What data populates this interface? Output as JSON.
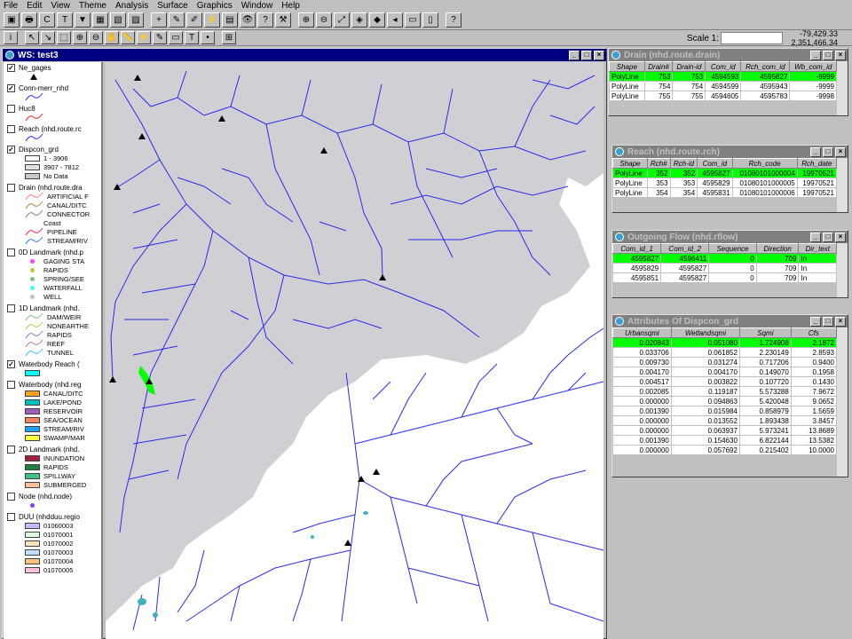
{
  "menubar": [
    "File",
    "Edit",
    "View",
    "Theme",
    "Analysis",
    "Surface",
    "Graphics",
    "Window",
    "Help"
  ],
  "toolbar1": [
    {
      "name": "save-icon",
      "glyph": "▣"
    },
    {
      "name": "print-icon",
      "glyph": "🖶"
    },
    {
      "name": "layout-icon",
      "glyph": "C"
    },
    {
      "name": "zoom-full-icon",
      "glyph": "T"
    },
    {
      "name": "down-arrow-icon",
      "glyph": "▼"
    },
    {
      "name": "table-icon",
      "glyph": "▦"
    },
    {
      "name": "chart-icon",
      "glyph": "▧"
    },
    {
      "name": "layout2-icon",
      "glyph": "▨"
    },
    {
      "name": "add-theme-icon",
      "glyph": "+"
    },
    {
      "name": "theme-props-icon",
      "glyph": "✎"
    },
    {
      "name": "edit-legend-icon",
      "glyph": "✐"
    },
    {
      "name": "hotlink-icon",
      "glyph": "⚡"
    },
    {
      "name": "open-table-icon",
      "glyph": "▤"
    },
    {
      "name": "binoculars-icon",
      "glyph": "👁"
    },
    {
      "name": "query-icon",
      "glyph": "?"
    },
    {
      "name": "hammer-icon",
      "glyph": "⚒"
    },
    {
      "name": "zoom-in-icon",
      "glyph": "⊕"
    },
    {
      "name": "zoom-out-icon",
      "glyph": "⊖"
    },
    {
      "name": "full-extent-icon",
      "glyph": "⤢"
    },
    {
      "name": "zoom-active-icon",
      "glyph": "◈"
    },
    {
      "name": "zoom-selected-icon",
      "glyph": "◆"
    },
    {
      "name": "zoom-previous-icon",
      "glyph": "◂"
    },
    {
      "name": "select-icon",
      "glyph": "▭"
    },
    {
      "name": "clear-select-icon",
      "glyph": "▯"
    },
    {
      "name": "help-icon",
      "glyph": "?"
    }
  ],
  "toolbar2": [
    {
      "name": "identify-icon",
      "glyph": "i"
    },
    {
      "name": "pointer-icon",
      "glyph": "↖"
    },
    {
      "name": "vertex-edit-icon",
      "glyph": "↘"
    },
    {
      "name": "select-feature-icon",
      "glyph": "⬚"
    },
    {
      "name": "zoom-in-tool-icon",
      "glyph": "⊕"
    },
    {
      "name": "zoom-out-tool-icon",
      "glyph": "⊖"
    },
    {
      "name": "pan-icon",
      "glyph": "✋"
    },
    {
      "name": "measure-icon",
      "glyph": "📏"
    },
    {
      "name": "hotlink-tool-icon",
      "glyph": "⚡"
    },
    {
      "name": "label-icon",
      "glyph": "✎"
    },
    {
      "name": "area-of-interest-icon",
      "glyph": "▭"
    },
    {
      "name": "text-tool-icon",
      "glyph": "T"
    },
    {
      "name": "draw-tool-icon",
      "glyph": "•"
    },
    {
      "name": "snap-icon",
      "glyph": "⊞"
    }
  ],
  "scale": {
    "label": "Scale 1:",
    "value": ""
  },
  "coords": {
    "x": "-79,429.33",
    "y": "2,351,466.34"
  },
  "view_window": {
    "title": "WS: test3"
  },
  "toc": [
    {
      "label": "Ne_gages",
      "checked": true,
      "legend": [
        {
          "kind": "triangle",
          "color": "#000000",
          "label": ""
        }
      ]
    },
    {
      "label": "Conn-merr_nhd",
      "checked": true,
      "legend": [
        {
          "kind": "line",
          "color": "#3030ff",
          "label": ""
        }
      ]
    },
    {
      "label": "Huc8",
      "checked": false,
      "legend": [
        {
          "kind": "line",
          "color": "#ff2020",
          "label": ""
        }
      ]
    },
    {
      "label": "Reach (nhd.route.rc",
      "checked": false,
      "legend": [
        {
          "kind": "line",
          "color": "#3030ff",
          "label": ""
        }
      ]
    },
    {
      "label": "Dispcon_grd",
      "checked": true,
      "legend": [
        {
          "kind": "swatch",
          "color": "#ffffff",
          "label": "1 - 3906"
        },
        {
          "kind": "swatch",
          "color": "#e0e0e0",
          "label": "3907 - 7812"
        },
        {
          "kind": "swatch",
          "color": "#c8c8c8",
          "label": "No Data"
        }
      ]
    },
    {
      "label": "Drain (nhd.route.dra",
      "checked": false,
      "legend": [
        {
          "kind": "line",
          "color": "#ff8080",
          "label": "ARTIFICIAL F"
        },
        {
          "kind": "line",
          "color": "#c08040",
          "label": "CANAL/DITC"
        },
        {
          "kind": "line",
          "color": "#808080",
          "label": "CONNECTOR"
        },
        {
          "kind": "text",
          "color": "",
          "label": "Coast"
        },
        {
          "kind": "line",
          "color": "#ff2060",
          "label": "PIPELINE"
        },
        {
          "kind": "line",
          "color": "#3080ff",
          "label": "STREAM/RIV"
        }
      ]
    },
    {
      "label": "0D Landmark (nhd.p",
      "checked": false,
      "legend": [
        {
          "kind": "dot",
          "color": "#ff40ff",
          "label": "GAGING STA"
        },
        {
          "kind": "dot",
          "color": "#c0c040",
          "label": "RAPIDS"
        },
        {
          "kind": "dot",
          "color": "#80c080",
          "label": "SPRING/SEE"
        },
        {
          "kind": "dot",
          "color": "#40ffff",
          "label": "WATERFALL"
        },
        {
          "kind": "dot",
          "color": "#c0c0c0",
          "label": "WELL"
        }
      ]
    },
    {
      "label": "1D Landmark (nhd.",
      "checked": false,
      "legend": [
        {
          "kind": "line",
          "color": "#80c080",
          "label": "DAM/WEIR"
        },
        {
          "kind": "line",
          "color": "#c0c040",
          "label": "NONEARTHE"
        },
        {
          "kind": "line",
          "color": "#8080c0",
          "label": "RAPIDS"
        },
        {
          "kind": "line",
          "color": "#c08080",
          "label": "REEF"
        },
        {
          "kind": "line",
          "color": "#40c0ff",
          "label": "TUNNEL"
        }
      ]
    },
    {
      "label": "Waterbody Reach (",
      "checked": true,
      "legend": [
        {
          "kind": "swatch",
          "color": "#00ffff",
          "label": ""
        }
      ]
    },
    {
      "label": "Waterbody (nhd.reg",
      "checked": false,
      "legend": [
        {
          "kind": "swatch",
          "color": "#ffa020",
          "label": "CANAL/DITC"
        },
        {
          "kind": "swatch",
          "color": "#00c0c0",
          "label": "LAKE/POND"
        },
        {
          "kind": "swatch",
          "color": "#a060c0",
          "label": "RESERVOIR"
        },
        {
          "kind": "swatch",
          "color": "#ff8060",
          "label": "SEA/OCEAN"
        },
        {
          "kind": "swatch",
          "color": "#20a0ff",
          "label": "STREAM/RIV"
        },
        {
          "kind": "swatch",
          "color": "#ffff40",
          "label": "SWAMP/MAR"
        }
      ]
    },
    {
      "label": "2D Landmark (nhd.",
      "checked": false,
      "legend": [
        {
          "kind": "swatch",
          "color": "#a02040",
          "label": "INUNDATION"
        },
        {
          "kind": "swatch",
          "color": "#208040",
          "label": "RAPIDS"
        },
        {
          "kind": "swatch",
          "color": "#40c080",
          "label": "SPILLWAY"
        },
        {
          "kind": "swatch",
          "color": "#ffc0a0",
          "label": "SUBMERGED"
        }
      ]
    },
    {
      "label": "Node (nhd.node)",
      "checked": false,
      "legend": [
        {
          "kind": "dot",
          "color": "#8040ff",
          "label": ""
        }
      ]
    },
    {
      "label": "DUU (nhdduu.regio",
      "checked": false,
      "legend": [
        {
          "kind": "swatch",
          "color": "#c0c0ff",
          "label": "01060003"
        },
        {
          "kind": "swatch",
          "color": "#e0ffe0",
          "label": "01070001"
        },
        {
          "kind": "swatch",
          "color": "#ffe0c0",
          "label": "01070002"
        },
        {
          "kind": "swatch",
          "color": "#c0e0ff",
          "label": "01070003"
        },
        {
          "kind": "swatch",
          "color": "#ffc080",
          "label": "01070004"
        },
        {
          "kind": "swatch",
          "color": "#ffc0e0",
          "label": "01070005"
        }
      ]
    }
  ],
  "gages": [
    [
      155,
      88
    ],
    [
      250,
      134
    ],
    [
      160,
      154
    ],
    [
      365,
      170
    ],
    [
      132,
      211
    ],
    [
      431,
      313
    ],
    [
      127,
      428
    ],
    [
      168,
      430
    ],
    [
      424,
      532
    ],
    [
      407,
      540
    ],
    [
      392,
      612
    ]
  ],
  "drain_table": {
    "title": "Drain (nhd.route.drain)",
    "columns": [
      "Shape",
      "Drain#",
      "Drain-id",
      "Com_id",
      "Rch_com_id",
      "Wb_com_id"
    ],
    "rows": [
      [
        "PolyLine",
        "753",
        "753",
        "4594593",
        "4595827",
        "-9999"
      ],
      [
        "PolyLine",
        "754",
        "754",
        "4594599",
        "4595943",
        "-9999"
      ],
      [
        "PolyLine",
        "755",
        "755",
        "4594605",
        "4595783",
        "-9998"
      ]
    ]
  },
  "reach_table": {
    "title": "Reach (nhd.route.rch)",
    "columns": [
      "Shape",
      "Rch#",
      "Rch-id",
      "Com_id",
      "Rch_code",
      "Rch_date"
    ],
    "rows": [
      [
        "PolyLine",
        "352",
        "352",
        "4595827",
        "01080101000004",
        "19970521"
      ],
      [
        "PolyLine",
        "353",
        "353",
        "4595829",
        "01080101000005",
        "19970521"
      ],
      [
        "PolyLine",
        "354",
        "354",
        "4595831",
        "01080101000006",
        "19970521"
      ]
    ]
  },
  "flow_table": {
    "title": "Outgoing Flow (nhd.rflow)",
    "columns": [
      "Com_id_1",
      "Com_id_2",
      "Sequence",
      "Direction",
      "Dir_text"
    ],
    "rows": [
      [
        "4595827",
        "4596411",
        "0",
        "709",
        "In"
      ],
      [
        "4595829",
        "4595827",
        "0",
        "709",
        "In"
      ],
      [
        "4595851",
        "4595827",
        "0",
        "709",
        "In"
      ]
    ]
  },
  "attr_table": {
    "title": "Attributes Of Dispcon_grd",
    "columns": [
      "Urbansqmi",
      "Wetlandsqmi",
      "Sqmi",
      "Cfs"
    ],
    "rows": [
      [
        "0.020843",
        "0.051080",
        "1.724908",
        "2.1872"
      ],
      [
        "0.033706",
        "0.061852",
        "2.230149",
        "2.8593"
      ],
      [
        "0.009730",
        "0.031274",
        "0.717206",
        "0.9400"
      ],
      [
        "0.004170",
        "0.004170",
        "0.149070",
        "0.1958"
      ],
      [
        "0.004517",
        "0.003822",
        "0.107720",
        "0.1430"
      ],
      [
        "0.002085",
        "0.119187",
        "5.573288",
        "7.9672"
      ],
      [
        "0.000000",
        "0.094863",
        "5.420048",
        "9.0652"
      ],
      [
        "0.001390",
        "0.015984",
        "0.858979",
        "1.5659"
      ],
      [
        "0.000000",
        "0.013552",
        "1.893438",
        "3.8457"
      ],
      [
        "0.000000",
        "0.063937",
        "5.973241",
        "13.8689"
      ],
      [
        "0.001390",
        "0.154630",
        "6.822144",
        "13.5382"
      ],
      [
        "0.000000",
        "0.057692",
        "0.215402",
        "10.0000"
      ]
    ]
  }
}
